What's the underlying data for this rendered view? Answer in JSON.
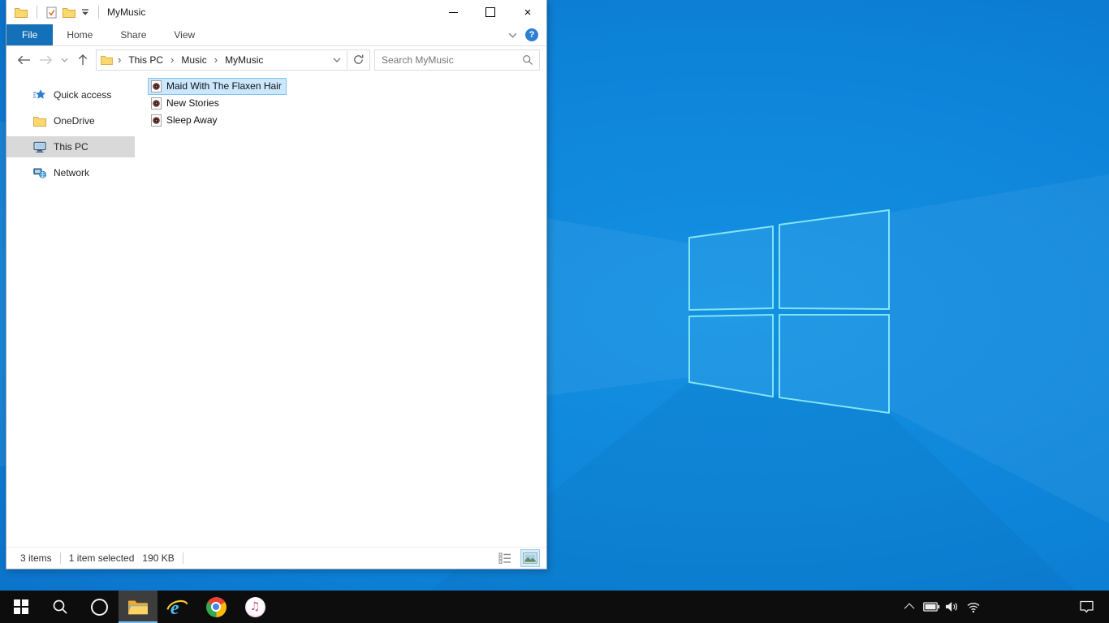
{
  "colors": {
    "desktop_blue": "#0d83d8",
    "accent_blue": "#0078d7",
    "file_tab_blue": "#1470b8",
    "selection_fill": "#cce8ff",
    "selection_border": "#84c4ef",
    "sidebar_selected_gray": "#d9d9d9",
    "taskbar_bg": "#0d0d0d",
    "taskbar_active_underline": "#76b9ed"
  },
  "window": {
    "title": "MyMusic",
    "controls": {
      "close_glyph": "×"
    },
    "ribbon": {
      "tabs": [
        {
          "label": "File",
          "active": true
        },
        {
          "label": "Home",
          "active": false
        },
        {
          "label": "Share",
          "active": false
        },
        {
          "label": "View",
          "active": false
        }
      ],
      "help_glyph": "?"
    },
    "navigation": {
      "breadcrumb": [
        "This PC",
        "Music",
        "MyMusic"
      ],
      "separator_glyph": "›",
      "search_placeholder": "Search MyMusic"
    },
    "sidebar": {
      "items": [
        {
          "label": "Quick access",
          "icon": "quick-access-star",
          "selected": false
        },
        {
          "label": "OneDrive",
          "icon": "folder",
          "selected": false
        },
        {
          "label": "This PC",
          "icon": "this-pc-monitor",
          "selected": true
        },
        {
          "label": "Network",
          "icon": "network-computer",
          "selected": false
        }
      ]
    },
    "files": [
      {
        "name": "Maid With The Flaxen Hair",
        "icon": "audio-file",
        "selected": true
      },
      {
        "name": "New Stories",
        "icon": "audio-file",
        "selected": false
      },
      {
        "name": "Sleep Away",
        "icon": "audio-file",
        "selected": false
      }
    ],
    "statusbar": {
      "items_count": "3 items",
      "selected_count": "1 item selected",
      "selected_size": "190 KB"
    }
  },
  "taskbar": {
    "buttons": [
      {
        "name": "start",
        "icon": "windows-logo"
      },
      {
        "name": "search",
        "icon": "magnifier"
      },
      {
        "name": "cortana",
        "icon": "circle"
      },
      {
        "name": "file-explorer",
        "icon": "folder",
        "active": true
      },
      {
        "name": "internet-explorer",
        "icon": "ie-e"
      },
      {
        "name": "chrome",
        "icon": "chrome-circle"
      },
      {
        "name": "itunes",
        "icon": "music-note",
        "glyph": "♫"
      }
    ],
    "tray": [
      {
        "name": "show-hidden-icons",
        "icon": "chevron-up"
      },
      {
        "name": "battery",
        "icon": "battery"
      },
      {
        "name": "volume",
        "icon": "speaker"
      },
      {
        "name": "wifi",
        "icon": "wifi"
      },
      {
        "name": "action-center",
        "icon": "chat-bubble"
      }
    ]
  },
  "desktop": {
    "wallpaper": "windows-10-light-rays-logo"
  }
}
